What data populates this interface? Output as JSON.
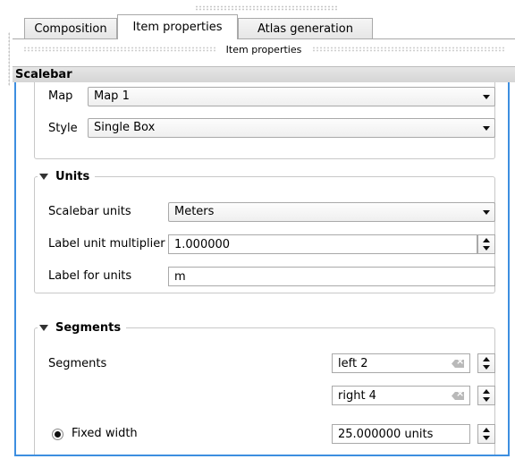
{
  "tabs": [
    {
      "label": "Composition"
    },
    {
      "label": "Item properties"
    },
    {
      "label": "Atlas generation"
    }
  ],
  "subheader": "Item properties",
  "section_title": "Scalebar",
  "map": {
    "label": "Map",
    "value": "Map 1"
  },
  "style": {
    "label": "Style",
    "value": "Single Box"
  },
  "units_group": {
    "title": "Units",
    "scalebar_units": {
      "label": "Scalebar units",
      "value": "Meters"
    },
    "multiplier": {
      "label": "Label unit multiplier",
      "value": "1.000000"
    },
    "label_units": {
      "label": "Label for units",
      "value": "m"
    }
  },
  "segments_group": {
    "title": "Segments",
    "segments_label": "Segments",
    "left": "left 2",
    "right": "right 4",
    "fixed_width": {
      "label": "Fixed width",
      "value": "25.000000 units"
    }
  },
  "icons": {
    "dropdown": "chevron-down-icon",
    "spin": "spin-arrows-icon",
    "clear": "clear-field-icon",
    "collapse": "triangle-down-icon"
  },
  "colors": {
    "focus_border": "#3d8ee0",
    "tab_border": "#a9a9a9"
  }
}
